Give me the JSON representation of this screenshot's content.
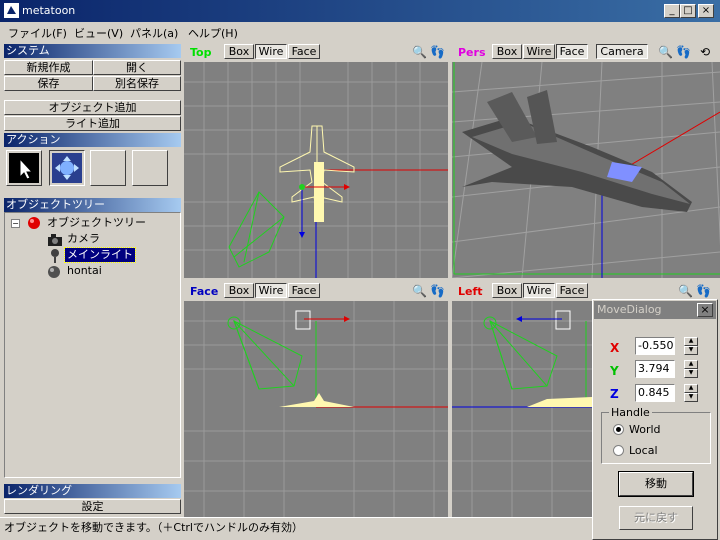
{
  "window": {
    "title": "metatoon"
  },
  "menu": [
    {
      "label": "ファイル(F)"
    },
    {
      "label": "ビュー(V)"
    },
    {
      "label": "パネル(a)"
    },
    {
      "label": "ヘルプ(H)"
    }
  ],
  "system": {
    "heading": "システム",
    "new_label": "新規作成",
    "open_label": "開く",
    "save_label": "保存",
    "save_as_label": "別名保存",
    "add_object_label": "オブジェクト追加",
    "add_light_label": "ライト追加"
  },
  "action": {
    "heading": "アクション"
  },
  "tree": {
    "heading": "オブジェクトツリー",
    "root": "オブジェクトツリー",
    "items": [
      "カメラ",
      "メインライト",
      "hontai"
    ],
    "selected_index": 1
  },
  "render": {
    "heading": "レンダリング",
    "settings_label": "設定"
  },
  "viewports": {
    "top": {
      "name": "Top",
      "name_color": "#00e000"
    },
    "pers": {
      "name": "Pers",
      "name_color": "#e000e0"
    },
    "face": {
      "name": "Face",
      "name_color": "#0000c0"
    },
    "left": {
      "name": "Left",
      "name_color": "#e00000"
    },
    "btn_box": "Box",
    "btn_wire": "Wire",
    "btn_face": "Face",
    "btn_camera": "Camera"
  },
  "dialog": {
    "title": "MoveDialog",
    "x_label": "X",
    "x_value": "-0.550",
    "y_label": "Y",
    "y_value": "3.794",
    "z_label": "Z",
    "z_value": "0.845",
    "handle_label": "Handle",
    "world_label": "World",
    "local_label": "Local",
    "move_label": "移動",
    "undo_label": "元に戻す"
  },
  "status": "オブジェクトを移動できます。（＋Ctrlでハンドルのみ有効）",
  "colors": {
    "x_axis": "#e00000",
    "y_axis": "#00c000",
    "z_axis": "#0000e0",
    "wire": "#fff8b0",
    "light_wire": "#20d020"
  }
}
